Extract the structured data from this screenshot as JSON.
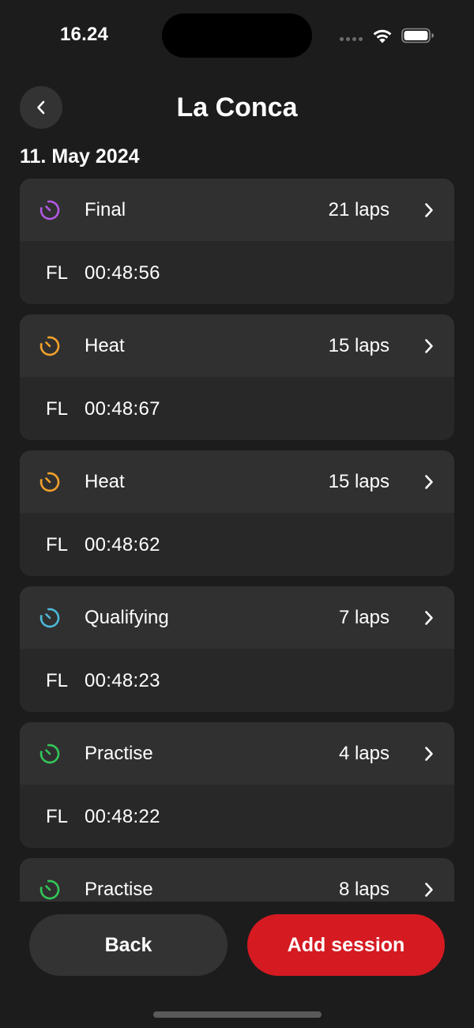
{
  "status_bar": {
    "time": "16.24"
  },
  "header": {
    "title": "La Conca",
    "back_icon": "chevron-left-icon"
  },
  "date_heading": "11. May 2024",
  "colors": {
    "final": "#b259e3",
    "heat": "#f2a12b",
    "qualifying": "#4db8d8",
    "practise": "#34c759",
    "accent": "#d51a22"
  },
  "sessions": [
    {
      "name": "Final",
      "laps": "21 laps",
      "fl_label": "FL",
      "fl_time": "00:48:56",
      "color": "#b259e3",
      "icon": "stopwatch-icon"
    },
    {
      "name": "Heat",
      "laps": "15 laps",
      "fl_label": "FL",
      "fl_time": "00:48:67",
      "color": "#f2a12b",
      "icon": "stopwatch-icon"
    },
    {
      "name": "Heat",
      "laps": "15 laps",
      "fl_label": "FL",
      "fl_time": "00:48:62",
      "color": "#f2a12b",
      "icon": "stopwatch-icon"
    },
    {
      "name": "Qualifying",
      "laps": "7 laps",
      "fl_label": "FL",
      "fl_time": "00:48:23",
      "color": "#4db8d8",
      "icon": "stopwatch-icon"
    },
    {
      "name": "Practise",
      "laps": "4 laps",
      "fl_label": "FL",
      "fl_time": "00:48:22",
      "color": "#34c759",
      "icon": "stopwatch-icon"
    },
    {
      "name": "Practise",
      "laps": "8 laps",
      "fl_label": "",
      "fl_time": "",
      "color": "#34c759",
      "icon": "stopwatch-icon"
    }
  ],
  "buttons": {
    "back_label": "Back",
    "add_label": "Add session"
  }
}
